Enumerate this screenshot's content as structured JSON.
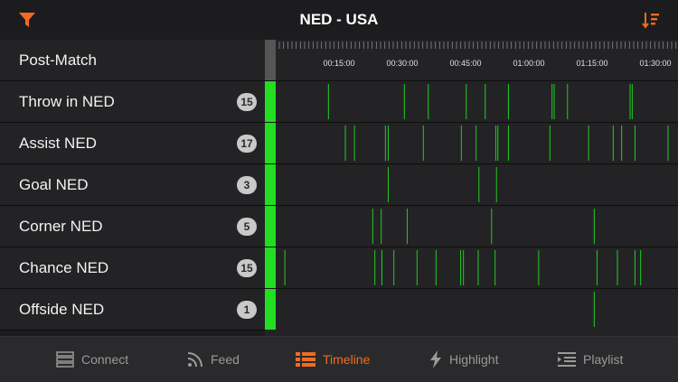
{
  "header": {
    "title": "NED - USA",
    "filter_icon": "filter-icon",
    "sort_icon": "sort-icon",
    "accent": "#f26b21"
  },
  "post_match": {
    "label": "Post-Match"
  },
  "time_ticks": [
    "00:15:00",
    "00:30:00",
    "00:45:00",
    "01:00:00",
    "01:15:00",
    "01:30:00"
  ],
  "rows": [
    {
      "label": "Throw in NED",
      "count": "15",
      "events": [
        "00:12:30",
        "00:30:30",
        "00:36:10",
        "00:45:10",
        "00:49:40",
        "00:55:10",
        "01:05:30",
        "01:06:00",
        "01:09:10",
        "01:24:00",
        "01:24:30",
        "01:35:30"
      ]
    },
    {
      "label": "Assist NED",
      "count": "17",
      "events": [
        "00:16:30",
        "00:18:40",
        "00:26:00",
        "00:26:40",
        "00:35:00",
        "00:44:00",
        "00:47:30",
        "00:52:10",
        "00:52:40",
        "00:55:10",
        "01:05:00",
        "01:14:10",
        "01:20:00",
        "01:22:00",
        "01:25:10",
        "01:33:00",
        "01:36:30"
      ]
    },
    {
      "label": "Goal NED",
      "count": "3",
      "events": [
        "00:26:40",
        "00:48:10",
        "00:52:20"
      ]
    },
    {
      "label": "Corner NED",
      "count": "5",
      "events": [
        "00:23:00",
        "00:25:00",
        "00:31:10",
        "00:51:10",
        "01:15:30"
      ]
    },
    {
      "label": "Chance NED",
      "count": "15",
      "events": [
        "00:02:10",
        "00:23:30",
        "00:25:10",
        "00:28:00",
        "00:33:30",
        "00:38:00",
        "00:43:50",
        "00:44:30",
        "00:48:00",
        "00:52:00",
        "01:02:20",
        "01:16:10",
        "01:21:00",
        "01:25:10",
        "01:26:30"
      ]
    },
    {
      "label": "Offside NED",
      "count": "1",
      "events": [
        "01:15:30"
      ]
    }
  ],
  "colors": {
    "event": "#22cc22",
    "indicator": "#22dd22",
    "tick": "#888888"
  },
  "nav": [
    {
      "label": "Connect",
      "icon": "server-icon",
      "active": false
    },
    {
      "label": "Feed",
      "icon": "rss-icon",
      "active": false
    },
    {
      "label": "Timeline",
      "icon": "list-icon",
      "active": true
    },
    {
      "label": "Highlight",
      "icon": "bolt-icon",
      "active": false
    },
    {
      "label": "Playlist",
      "icon": "playlist-icon",
      "active": false
    }
  ]
}
